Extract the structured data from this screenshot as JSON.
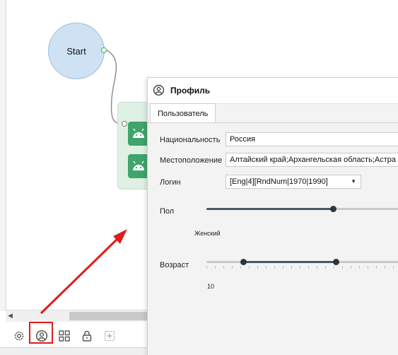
{
  "canvas": {
    "start_node_label": "Start"
  },
  "profile_window": {
    "title": "Профиль",
    "tabs": [
      {
        "label": "Пользователь"
      }
    ],
    "fields": {
      "nationality": {
        "label": "Национальность",
        "value": "Россия"
      },
      "location": {
        "label": "Местоположение",
        "value": "Алтайский край;Архангельская область;Астра"
      },
      "login": {
        "label": "Логин",
        "value": "[Eng|4][RndNum|1970|1990]"
      }
    },
    "gender": {
      "label": "Пол",
      "value_label": "Женский"
    },
    "age": {
      "label": "Возраст",
      "min_label": "10"
    }
  },
  "toolbar": {
    "items": [
      {
        "icon": "gear-icon"
      },
      {
        "icon": "user-profile-icon",
        "highlighted": true
      },
      {
        "icon": "grid-icon"
      },
      {
        "icon": "lock-icon"
      },
      {
        "icon": "add-icon"
      }
    ]
  },
  "colors": {
    "start_node": "#cfe2f3",
    "action_tile": "#3fa56b",
    "highlight": "#e01b1b",
    "slider_fill": "#4a5568"
  }
}
